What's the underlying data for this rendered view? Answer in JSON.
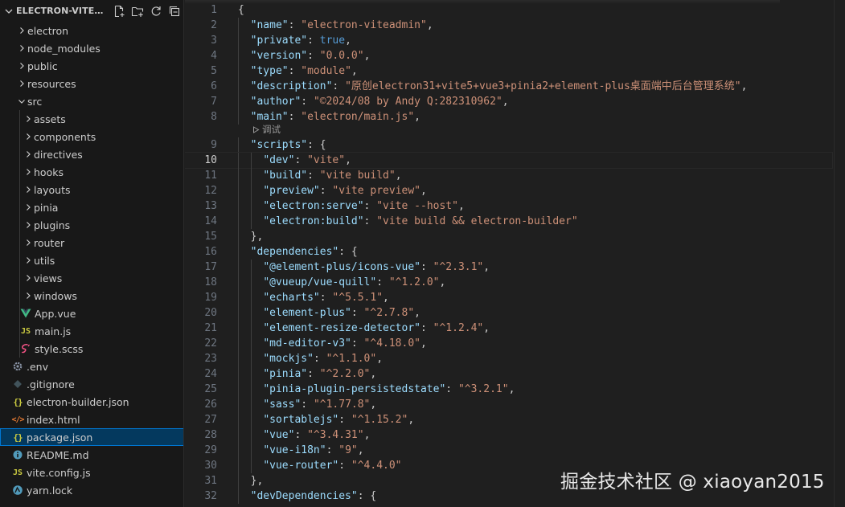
{
  "explorer": {
    "title": "ELECTRON-VITEADMIN",
    "actions": [
      "new-file",
      "new-folder",
      "refresh",
      "collapse-all"
    ],
    "items": [
      {
        "label": "electron",
        "type": "folder",
        "depth": 0,
        "expanded": false
      },
      {
        "label": "node_modules",
        "type": "folder",
        "depth": 0,
        "expanded": false
      },
      {
        "label": "public",
        "type": "folder",
        "depth": 0,
        "expanded": false
      },
      {
        "label": "resources",
        "type": "folder",
        "depth": 0,
        "expanded": false
      },
      {
        "label": "src",
        "type": "folder",
        "depth": 0,
        "expanded": true
      },
      {
        "label": "assets",
        "type": "folder",
        "depth": 1,
        "expanded": false
      },
      {
        "label": "components",
        "type": "folder",
        "depth": 1,
        "expanded": false
      },
      {
        "label": "directives",
        "type": "folder",
        "depth": 1,
        "expanded": false
      },
      {
        "label": "hooks",
        "type": "folder",
        "depth": 1,
        "expanded": false
      },
      {
        "label": "layouts",
        "type": "folder",
        "depth": 1,
        "expanded": false
      },
      {
        "label": "pinia",
        "type": "folder",
        "depth": 1,
        "expanded": false
      },
      {
        "label": "plugins",
        "type": "folder",
        "depth": 1,
        "expanded": false
      },
      {
        "label": "router",
        "type": "folder",
        "depth": 1,
        "expanded": false
      },
      {
        "label": "utils",
        "type": "folder",
        "depth": 1,
        "expanded": false
      },
      {
        "label": "views",
        "type": "folder",
        "depth": 1,
        "expanded": false
      },
      {
        "label": "windows",
        "type": "folder",
        "depth": 1,
        "expanded": false
      },
      {
        "label": "App.vue",
        "type": "file",
        "icon": "vue-icon",
        "depth": 1
      },
      {
        "label": "main.js",
        "type": "file",
        "icon": "js-icon",
        "depth": 1
      },
      {
        "label": "style.scss",
        "type": "file",
        "icon": "sass-icon",
        "depth": 1
      },
      {
        "label": ".env",
        "type": "file",
        "icon": "gear-icon",
        "depth": 0
      },
      {
        "label": ".gitignore",
        "type": "file",
        "icon": "git-icon",
        "depth": 0
      },
      {
        "label": "electron-builder.json",
        "type": "file",
        "icon": "json-icon",
        "depth": 0
      },
      {
        "label": "index.html",
        "type": "file",
        "icon": "html-icon",
        "depth": 0
      },
      {
        "label": "package.json",
        "type": "file",
        "icon": "json-icon",
        "depth": 0,
        "selected": true
      },
      {
        "label": "README.md",
        "type": "file",
        "icon": "info-icon",
        "depth": 0
      },
      {
        "label": "vite.config.js",
        "type": "file",
        "icon": "js-icon",
        "depth": 0
      },
      {
        "label": "yarn.lock",
        "type": "file",
        "icon": "yarn-icon",
        "depth": 0
      }
    ]
  },
  "editor": {
    "file": "package.json",
    "current_line": 10,
    "codelens": {
      "after_line": 8,
      "label": "调试"
    },
    "lines": [
      {
        "n": "1",
        "indent": 0,
        "tokens": [
          {
            "t": "p",
            "v": "{"
          }
        ]
      },
      {
        "n": "2",
        "indent": 1,
        "tokens": [
          {
            "t": "k",
            "v": "\"name\""
          },
          {
            "t": "p",
            "v": ": "
          },
          {
            "t": "s",
            "v": "\"electron-viteadmin\""
          },
          {
            "t": "p",
            "v": ","
          }
        ]
      },
      {
        "n": "3",
        "indent": 1,
        "tokens": [
          {
            "t": "k",
            "v": "\"private\""
          },
          {
            "t": "p",
            "v": ": "
          },
          {
            "t": "b",
            "v": "true"
          },
          {
            "t": "p",
            "v": ","
          }
        ]
      },
      {
        "n": "4",
        "indent": 1,
        "tokens": [
          {
            "t": "k",
            "v": "\"version\""
          },
          {
            "t": "p",
            "v": ": "
          },
          {
            "t": "s",
            "v": "\"0.0.0\""
          },
          {
            "t": "p",
            "v": ","
          }
        ]
      },
      {
        "n": "5",
        "indent": 1,
        "tokens": [
          {
            "t": "k",
            "v": "\"type\""
          },
          {
            "t": "p",
            "v": ": "
          },
          {
            "t": "s",
            "v": "\"module\""
          },
          {
            "t": "p",
            "v": ","
          }
        ]
      },
      {
        "n": "6",
        "indent": 1,
        "tokens": [
          {
            "t": "k",
            "v": "\"description\""
          },
          {
            "t": "p",
            "v": ": "
          },
          {
            "t": "s",
            "v": "\"原创electron31+vite5+vue3+pinia2+element-plus桌面端中后台管理系统\""
          },
          {
            "t": "p",
            "v": ","
          }
        ]
      },
      {
        "n": "7",
        "indent": 1,
        "tokens": [
          {
            "t": "k",
            "v": "\"author\""
          },
          {
            "t": "p",
            "v": ": "
          },
          {
            "t": "s",
            "v": "\"©2024/08 by Andy Q:282310962\""
          },
          {
            "t": "p",
            "v": ","
          }
        ]
      },
      {
        "n": "8",
        "indent": 1,
        "tokens": [
          {
            "t": "k",
            "v": "\"main\""
          },
          {
            "t": "p",
            "v": ": "
          },
          {
            "t": "s",
            "v": "\"electron/main.js\""
          },
          {
            "t": "p",
            "v": ","
          }
        ]
      },
      {
        "n": "9",
        "indent": 1,
        "tokens": [
          {
            "t": "k",
            "v": "\"scripts\""
          },
          {
            "t": "p",
            "v": ": {"
          }
        ]
      },
      {
        "n": "10",
        "indent": 2,
        "tokens": [
          {
            "t": "k",
            "v": "\"dev\""
          },
          {
            "t": "p",
            "v": ": "
          },
          {
            "t": "s",
            "v": "\"vite\""
          },
          {
            "t": "p",
            "v": ","
          }
        ]
      },
      {
        "n": "11",
        "indent": 2,
        "tokens": [
          {
            "t": "k",
            "v": "\"build\""
          },
          {
            "t": "p",
            "v": ": "
          },
          {
            "t": "s",
            "v": "\"vite build\""
          },
          {
            "t": "p",
            "v": ","
          }
        ]
      },
      {
        "n": "12",
        "indent": 2,
        "tokens": [
          {
            "t": "k",
            "v": "\"preview\""
          },
          {
            "t": "p",
            "v": ": "
          },
          {
            "t": "s",
            "v": "\"vite preview\""
          },
          {
            "t": "p",
            "v": ","
          }
        ]
      },
      {
        "n": "13",
        "indent": 2,
        "tokens": [
          {
            "t": "k",
            "v": "\"electron:serve\""
          },
          {
            "t": "p",
            "v": ": "
          },
          {
            "t": "s",
            "v": "\"vite --host\""
          },
          {
            "t": "p",
            "v": ","
          }
        ]
      },
      {
        "n": "14",
        "indent": 2,
        "tokens": [
          {
            "t": "k",
            "v": "\"electron:build\""
          },
          {
            "t": "p",
            "v": ": "
          },
          {
            "t": "s",
            "v": "\"vite build && electron-builder\""
          }
        ]
      },
      {
        "n": "15",
        "indent": 1,
        "tokens": [
          {
            "t": "p",
            "v": "},"
          }
        ]
      },
      {
        "n": "16",
        "indent": 1,
        "tokens": [
          {
            "t": "k",
            "v": "\"dependencies\""
          },
          {
            "t": "p",
            "v": ": {"
          }
        ]
      },
      {
        "n": "17",
        "indent": 2,
        "tokens": [
          {
            "t": "k",
            "v": "\"@element-plus/icons-vue\""
          },
          {
            "t": "p",
            "v": ": "
          },
          {
            "t": "s",
            "v": "\"^2.3.1\""
          },
          {
            "t": "p",
            "v": ","
          }
        ]
      },
      {
        "n": "18",
        "indent": 2,
        "tokens": [
          {
            "t": "k",
            "v": "\"@vueup/vue-quill\""
          },
          {
            "t": "p",
            "v": ": "
          },
          {
            "t": "s",
            "v": "\"^1.2.0\""
          },
          {
            "t": "p",
            "v": ","
          }
        ]
      },
      {
        "n": "19",
        "indent": 2,
        "tokens": [
          {
            "t": "k",
            "v": "\"echarts\""
          },
          {
            "t": "p",
            "v": ": "
          },
          {
            "t": "s",
            "v": "\"^5.5.1\""
          },
          {
            "t": "p",
            "v": ","
          }
        ]
      },
      {
        "n": "20",
        "indent": 2,
        "tokens": [
          {
            "t": "k",
            "v": "\"element-plus\""
          },
          {
            "t": "p",
            "v": ": "
          },
          {
            "t": "s",
            "v": "\"^2.7.8\""
          },
          {
            "t": "p",
            "v": ","
          }
        ]
      },
      {
        "n": "21",
        "indent": 2,
        "tokens": [
          {
            "t": "k",
            "v": "\"element-resize-detector\""
          },
          {
            "t": "p",
            "v": ": "
          },
          {
            "t": "s",
            "v": "\"^1.2.4\""
          },
          {
            "t": "p",
            "v": ","
          }
        ]
      },
      {
        "n": "22",
        "indent": 2,
        "tokens": [
          {
            "t": "k",
            "v": "\"md-editor-v3\""
          },
          {
            "t": "p",
            "v": ": "
          },
          {
            "t": "s",
            "v": "\"^4.18.0\""
          },
          {
            "t": "p",
            "v": ","
          }
        ]
      },
      {
        "n": "23",
        "indent": 2,
        "tokens": [
          {
            "t": "k",
            "v": "\"mockjs\""
          },
          {
            "t": "p",
            "v": ": "
          },
          {
            "t": "s",
            "v": "\"^1.1.0\""
          },
          {
            "t": "p",
            "v": ","
          }
        ]
      },
      {
        "n": "24",
        "indent": 2,
        "tokens": [
          {
            "t": "k",
            "v": "\"pinia\""
          },
          {
            "t": "p",
            "v": ": "
          },
          {
            "t": "s",
            "v": "\"^2.2.0\""
          },
          {
            "t": "p",
            "v": ","
          }
        ]
      },
      {
        "n": "25",
        "indent": 2,
        "tokens": [
          {
            "t": "k",
            "v": "\"pinia-plugin-persistedstate\""
          },
          {
            "t": "p",
            "v": ": "
          },
          {
            "t": "s",
            "v": "\"^3.2.1\""
          },
          {
            "t": "p",
            "v": ","
          }
        ]
      },
      {
        "n": "26",
        "indent": 2,
        "tokens": [
          {
            "t": "k",
            "v": "\"sass\""
          },
          {
            "t": "p",
            "v": ": "
          },
          {
            "t": "s",
            "v": "\"^1.77.8\""
          },
          {
            "t": "p",
            "v": ","
          }
        ]
      },
      {
        "n": "27",
        "indent": 2,
        "tokens": [
          {
            "t": "k",
            "v": "\"sortablejs\""
          },
          {
            "t": "p",
            "v": ": "
          },
          {
            "t": "s",
            "v": "\"^1.15.2\""
          },
          {
            "t": "p",
            "v": ","
          }
        ]
      },
      {
        "n": "28",
        "indent": 2,
        "tokens": [
          {
            "t": "k",
            "v": "\"vue\""
          },
          {
            "t": "p",
            "v": ": "
          },
          {
            "t": "s",
            "v": "\"^3.4.31\""
          },
          {
            "t": "p",
            "v": ","
          }
        ]
      },
      {
        "n": "29",
        "indent": 2,
        "tokens": [
          {
            "t": "k",
            "v": "\"vue-i18n\""
          },
          {
            "t": "p",
            "v": ": "
          },
          {
            "t": "s",
            "v": "\"9\""
          },
          {
            "t": "p",
            "v": ","
          }
        ]
      },
      {
        "n": "30",
        "indent": 2,
        "tokens": [
          {
            "t": "k",
            "v": "\"vue-router\""
          },
          {
            "t": "p",
            "v": ": "
          },
          {
            "t": "s",
            "v": "\"^4.4.0\""
          }
        ]
      },
      {
        "n": "31",
        "indent": 1,
        "tokens": [
          {
            "t": "p",
            "v": "},"
          }
        ]
      },
      {
        "n": "32",
        "indent": 1,
        "tokens": [
          {
            "t": "k",
            "v": "\"devDependencies\""
          },
          {
            "t": "p",
            "v": ": {"
          }
        ]
      }
    ]
  },
  "watermark": "掘金技术社区 @ xiaoyan2015",
  "colors": {
    "sidebar_bg": "#181818",
    "editor_bg": "#1f1f1f",
    "selection": "#04395e",
    "focus_border": "#0078d4",
    "json_key": "#9cdcfe",
    "json_string": "#ce9178",
    "json_keyword": "#569cd6",
    "vue": "#41b883",
    "js": "#cbcb41",
    "sass": "#f55385",
    "html": "#e37933",
    "json": "#cbcb41",
    "info": "#519aba"
  }
}
